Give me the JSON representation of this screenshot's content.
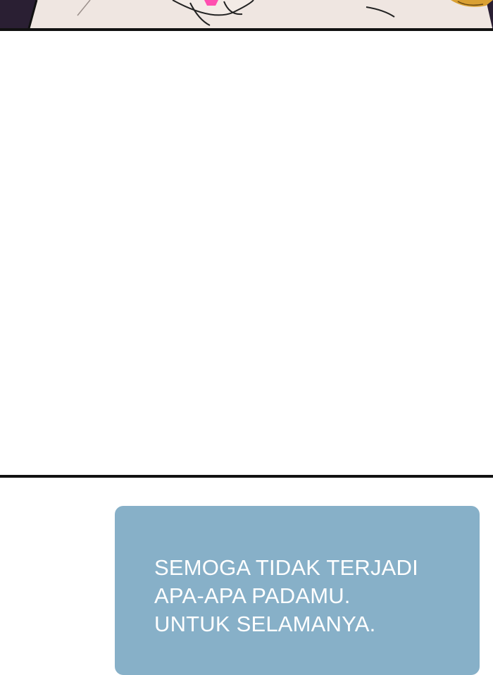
{
  "caption": {
    "lines": [
      "SEMOGA TIDAK TERJADI",
      "APA-APA PADAMU.",
      "UNTUK SELAMANYA."
    ]
  },
  "colors": {
    "caption_background": "#87b0c8",
    "caption_text": "#ffffff",
    "panel_border": "#111111",
    "top_panel_background": "#2a1f33"
  }
}
